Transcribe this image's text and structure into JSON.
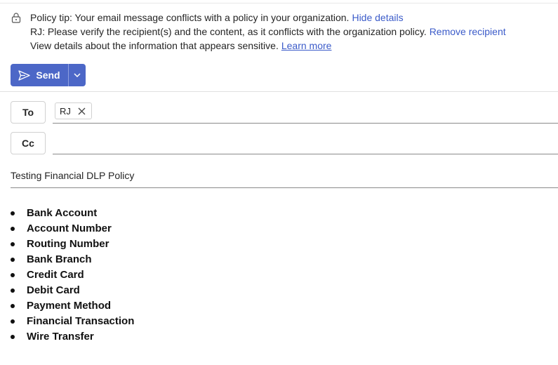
{
  "policy_tip": {
    "line1_text": "Policy tip: Your email message conflicts with a policy in your organization.",
    "line1_link": "Hide details",
    "line2_text": "RJ: Please verify the recipient(s) and the content, as it conflicts with the organization policy.",
    "line2_link": "Remove recipient",
    "line3_text": "View details about the information that appears sensitive.",
    "line3_link": "Learn more"
  },
  "toolbar": {
    "send_label": "Send",
    "accent_color": "#4c67c7"
  },
  "recipients": {
    "to_label": "To",
    "cc_label": "Cc",
    "to_chips": [
      "RJ"
    ]
  },
  "subject": {
    "value": "Testing Financial DLP Policy"
  },
  "body": {
    "items": [
      "Bank Account",
      "Account Number",
      "Routing Number",
      "Bank Branch",
      "Credit Card",
      "Debit Card",
      "Payment Method",
      "Financial Transaction",
      "Wire Transfer"
    ]
  },
  "icons": {
    "policy": "lock-icon",
    "send": "send-icon",
    "dropdown": "chevron-down-icon",
    "remove_chip": "close-icon"
  }
}
